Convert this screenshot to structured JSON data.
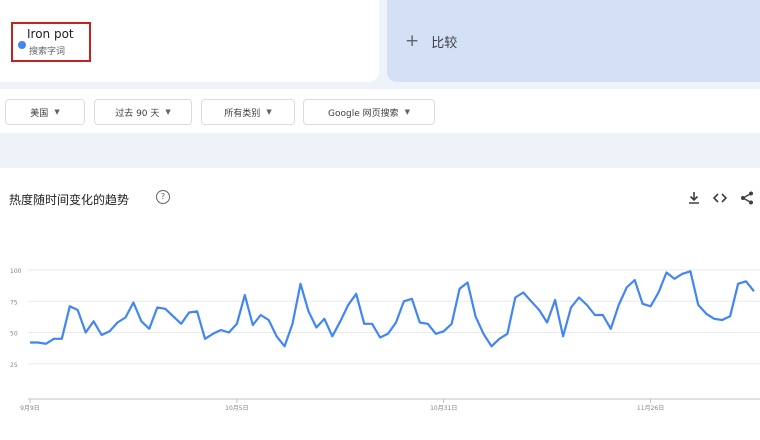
{
  "search_term": {
    "name": "Iron pot",
    "type_label": "搜索字词",
    "color": "#4285f4"
  },
  "compare": {
    "icon": "plus-icon",
    "label": "比较"
  },
  "filters": {
    "region": "美国",
    "time_range": "过去 90 天",
    "category": "所有类别",
    "search_type": "Google 网页搜索"
  },
  "chart": {
    "title": "热度随时间变化的趋势",
    "help_icon": "help-circle-icon",
    "tools": [
      "download-icon",
      "embed-icon",
      "share-icon"
    ]
  },
  "chart_data": {
    "type": "line",
    "title": "热度随时间变化的趋势",
    "ylim": [
      0,
      100
    ],
    "y_ticks": [
      25,
      50,
      75,
      100
    ],
    "x_tick_labels": [
      "9月9日",
      "10月5日",
      "10月31日",
      "11月26日"
    ],
    "x_tick_indices": [
      0,
      26,
      52,
      78
    ],
    "grid": true,
    "series": [
      {
        "color": "#4285f4",
        "values": [
          42,
          42,
          41,
          45,
          45,
          71,
          68,
          50,
          59,
          48,
          51,
          58,
          62,
          74,
          59,
          53,
          70,
          69,
          63,
          57,
          66,
          67,
          45,
          49,
          52,
          50,
          57,
          80,
          56,
          64,
          60,
          47,
          39,
          57,
          89,
          67,
          54,
          61,
          47,
          59,
          72,
          81,
          57,
          57,
          46,
          49,
          58,
          75,
          77,
          58,
          57,
          49,
          51,
          57,
          85,
          90,
          63,
          49,
          39,
          45,
          49,
          78,
          82,
          75,
          68,
          58,
          76,
          47,
          70,
          78,
          72,
          64,
          64,
          53,
          72,
          86,
          92,
          73,
          71,
          82,
          98,
          93,
          97,
          99,
          72,
          65,
          61,
          60,
          63,
          89,
          91,
          83
        ]
      }
    ]
  }
}
